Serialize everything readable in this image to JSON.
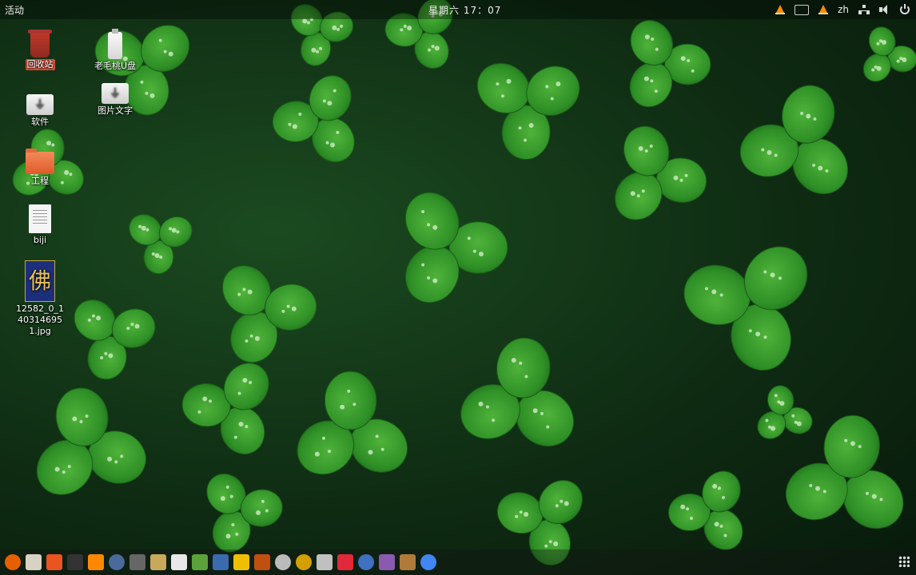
{
  "topbar": {
    "activities": "活动",
    "clock": "星期六 17：07",
    "input_method": "zh",
    "tray_icons": [
      "vlc-icon",
      "screen-recorder-icon",
      "vlc-icon",
      "input-method-label",
      "network-icon",
      "volume-icon",
      "power-icon"
    ]
  },
  "desktop": {
    "icons": [
      {
        "label": "回收站",
        "icon": "trash-icon",
        "selected": true
      },
      {
        "label": "老毛桃U盘",
        "icon": "usb-drive-icon"
      },
      {
        "label": "软件",
        "icon": "drive-icon"
      },
      {
        "label": "图片文字",
        "icon": "drive-icon"
      },
      {
        "label": "工程",
        "icon": "folder-icon"
      },
      {
        "label": "biji",
        "icon": "text-document-icon"
      },
      {
        "label": "12582_0_1403146951.jpg",
        "icon": "image-file-icon",
        "thumb_glyph": "佛"
      }
    ]
  },
  "dock": {
    "apps": [
      {
        "name": "firefox-icon",
        "color": "#e66000"
      },
      {
        "name": "files-icon",
        "color": "#d8d2c4"
      },
      {
        "name": "software-center-icon",
        "color": "#e95420"
      },
      {
        "name": "terminal-icon",
        "color": "#333333"
      },
      {
        "name": "vlc-icon",
        "color": "#ff8800"
      },
      {
        "name": "clock-icon",
        "color": "#4a6a9a"
      },
      {
        "name": "tool-icon",
        "color": "#666666"
      },
      {
        "name": "archive-icon",
        "color": "#c8a85a"
      },
      {
        "name": "text-editor-icon",
        "color": "#e8e8e8"
      },
      {
        "name": "green-app-icon",
        "color": "#5ba23b"
      },
      {
        "name": "xterm-icon",
        "color": "#3a6ab0"
      },
      {
        "name": "yellow-app-icon",
        "color": "#f0c000"
      },
      {
        "name": "cone-app-icon",
        "color": "#c05010"
      },
      {
        "name": "disc-icon",
        "color": "#bbbbbb"
      },
      {
        "name": "music-player-icon",
        "color": "#d4a000"
      },
      {
        "name": "mail-icon",
        "color": "#c0c0c0"
      },
      {
        "name": "music-icon",
        "color": "#e02a3a"
      },
      {
        "name": "globe-icon",
        "color": "#4070c0"
      },
      {
        "name": "video-icon",
        "color": "#8a5ab0"
      },
      {
        "name": "package-icon",
        "color": "#b07a3a"
      },
      {
        "name": "chrome-icon",
        "color": "#4285f4"
      }
    ]
  }
}
